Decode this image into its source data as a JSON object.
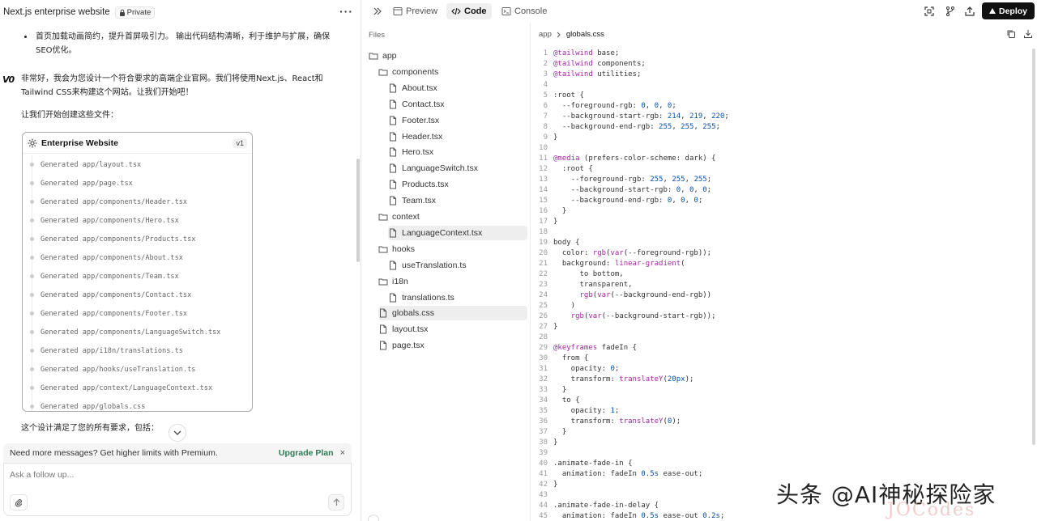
{
  "chat": {
    "title": "Next.js enterprise website",
    "private_label": "Private",
    "bullet_text": "首页加载动画简约，提升首屏吸引力。 输出代码结构清晰，利于维护与扩展，确保SEO优化。",
    "logo": "V0",
    "intro_text": "非常好，我会为您设计一个符合要求的高端企业官网。我们将使用Next.js、React和Tailwind CSS来构建这个网站。让我们开始吧！",
    "lets_create": "让我们开始创建这些文件：",
    "summary_text": "这个设计满足了您的所有要求，包括："
  },
  "card": {
    "title": "Enterprise Website",
    "version": "v1",
    "items": [
      "Generated app/layout.tsx",
      "Generated app/page.tsx",
      "Generated app/components/Header.tsx",
      "Generated app/components/Hero.tsx",
      "Generated app/components/Products.tsx",
      "Generated app/components/About.tsx",
      "Generated app/components/Team.tsx",
      "Generated app/components/Contact.tsx",
      "Generated app/components/Footer.tsx",
      "Generated app/components/LanguageSwitch.tsx",
      "Generated app/i18n/translations.ts",
      "Generated app/hooks/useTranslation.ts",
      "Generated app/context/LanguageContext.tsx",
      "Generated app/globals.css"
    ]
  },
  "upgrade": {
    "message": "Need more messages? Get higher limits with Premium.",
    "link": "Upgrade Plan",
    "close": "×"
  },
  "followup": {
    "placeholder": "Ask a follow up..."
  },
  "toolbar": {
    "tabs": [
      "Preview",
      "Code",
      "Console"
    ],
    "deploy": "Deploy"
  },
  "files": {
    "label": "Files",
    "tree": [
      {
        "name": "app",
        "type": "folder",
        "depth": 0
      },
      {
        "name": "components",
        "type": "folder",
        "depth": 1
      },
      {
        "name": "About.tsx",
        "type": "file",
        "depth": 2
      },
      {
        "name": "Contact.tsx",
        "type": "file",
        "depth": 2
      },
      {
        "name": "Footer.tsx",
        "type": "file",
        "depth": 2
      },
      {
        "name": "Header.tsx",
        "type": "file",
        "depth": 2
      },
      {
        "name": "Hero.tsx",
        "type": "file",
        "depth": 2
      },
      {
        "name": "LanguageSwitch.tsx",
        "type": "file",
        "depth": 2
      },
      {
        "name": "Products.tsx",
        "type": "file",
        "depth": 2
      },
      {
        "name": "Team.tsx",
        "type": "file",
        "depth": 2
      },
      {
        "name": "context",
        "type": "folder",
        "depth": 1
      },
      {
        "name": "LanguageContext.tsx",
        "type": "file",
        "depth": 2,
        "selected": true
      },
      {
        "name": "hooks",
        "type": "folder",
        "depth": 1
      },
      {
        "name": "useTranslation.ts",
        "type": "file",
        "depth": 2
      },
      {
        "name": "i18n",
        "type": "folder",
        "depth": 1
      },
      {
        "name": "translations.ts",
        "type": "file",
        "depth": 2
      },
      {
        "name": "globals.css",
        "type": "file",
        "depth": 1,
        "selected": true
      },
      {
        "name": "layout.tsx",
        "type": "file",
        "depth": 1
      },
      {
        "name": "page.tsx",
        "type": "file",
        "depth": 1
      }
    ]
  },
  "editor": {
    "breadcrumb": [
      "app",
      "globals.css"
    ],
    "lines": [
      "@tailwind base;",
      "@tailwind components;",
      "@tailwind utilities;",
      "",
      ":root {",
      "  --foreground-rgb: 0, 0, 0;",
      "  --background-start-rgb: 214, 219, 220;",
      "  --background-end-rgb: 255, 255, 255;",
      "}",
      "",
      "@media (prefers-color-scheme: dark) {",
      "  :root {",
      "    --foreground-rgb: 255, 255, 255;",
      "    --background-start-rgb: 0, 0, 0;",
      "    --background-end-rgb: 0, 0, 0;",
      "  }",
      "}",
      "",
      "body {",
      "  color: rgb(var(--foreground-rgb));",
      "  background: linear-gradient(",
      "      to bottom,",
      "      transparent,",
      "      rgb(var(--background-end-rgb))",
      "    )",
      "    rgb(var(--background-start-rgb));",
      "}",
      "",
      "@keyframes fadeIn {",
      "  from {",
      "    opacity: 0;",
      "    transform: translateY(20px);",
      "  }",
      "  to {",
      "    opacity: 1;",
      "    transform: translateY(0);",
      "  }",
      "}",
      "",
      ".animate-fade-in {",
      "  animation: fadeIn 0.5s ease-out;",
      "}",
      "",
      ".animate-fade-in-delay {",
      "  animation: fadeIn 0.5s ease-out 0.2s;"
    ]
  },
  "watermark": {
    "text": "头条 @AI神秘探险家",
    "faint": "JOCodes"
  },
  "colors": {
    "accent": "#2f7a5a",
    "deploy_bg": "#111111",
    "selected_bg": "#eeeeee"
  }
}
